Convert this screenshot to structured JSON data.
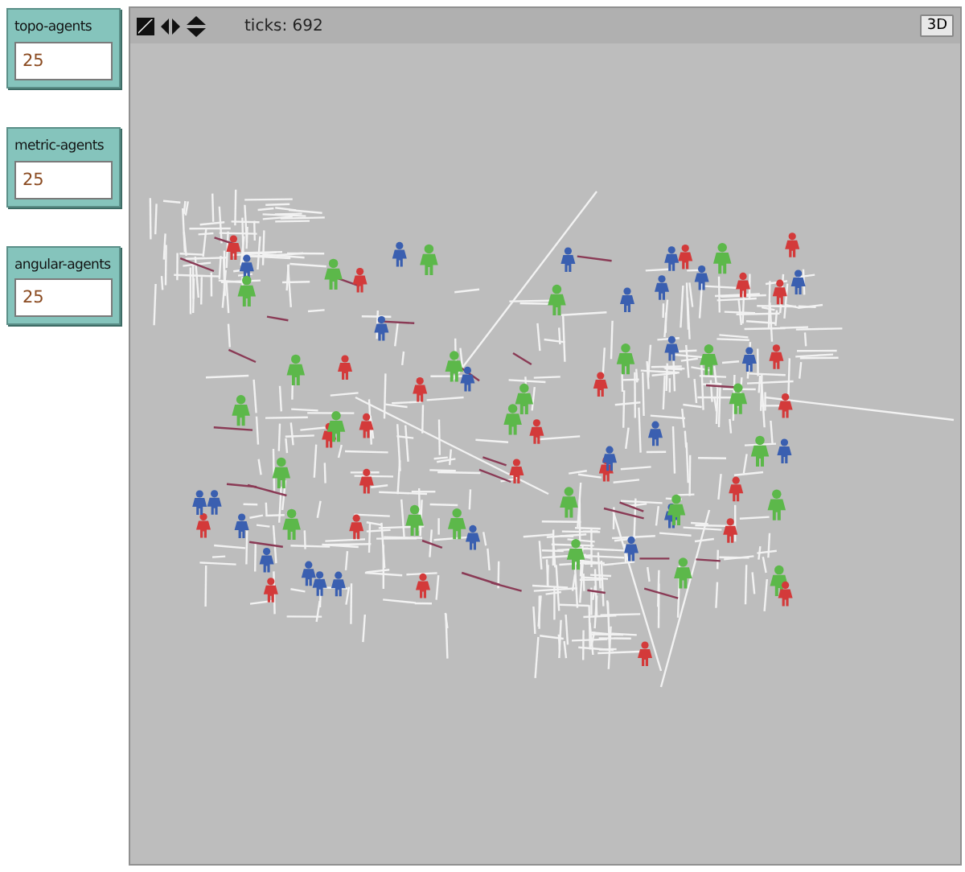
{
  "inputs": [
    {
      "label": "topo-agents",
      "value": "25"
    },
    {
      "label": "metric-agents",
      "value": "25"
    },
    {
      "label": "angular-agents",
      "value": "25"
    }
  ],
  "view": {
    "ticks": "ticks: 692",
    "button": "3D"
  }
}
